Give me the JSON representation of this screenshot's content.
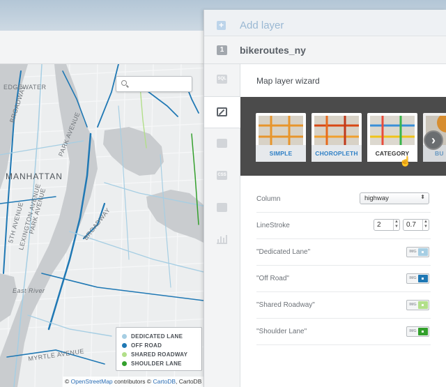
{
  "map": {
    "labels": [
      "EDGEWATER",
      "MANHATTAN",
      "BROADWAY",
      "PARK AVENUE",
      "BROADWAY",
      "East River",
      "MYRTLE AVENUE",
      "LEXINGTON AVENUE",
      "5TH AVENUE",
      "PARK AVENUE"
    ],
    "legend": [
      {
        "label": "DEDICATED LANE",
        "color": "#a6cee3"
      },
      {
        "label": "OFF ROAD",
        "color": "#1f78b4"
      },
      {
        "label": "SHARED ROADWAY",
        "color": "#b2df8a"
      },
      {
        "label": "SHOULDER LANE",
        "color": "#33a02c"
      }
    ],
    "attribution": {
      "prefix": "©",
      "osm": "OpenStreetMap",
      "middle": "contributors ©",
      "carto": "CartoDB",
      "suffix": ", CartoDB"
    }
  },
  "pane": {
    "add_layer": "Add layer",
    "layer_number": "1",
    "layer_name": "bikeroutes_ny",
    "tabs": {
      "sql": "SQL",
      "css": "CSS"
    }
  },
  "wizard": {
    "title": "Map layer wizard",
    "cards": [
      {
        "label": "SIMPLE"
      },
      {
        "label": "CHOROPLETH"
      },
      {
        "label": "CATEGORY",
        "selected": true
      },
      {
        "label": "BU"
      }
    ],
    "column": {
      "label": "Column",
      "value": "highway"
    },
    "linestroke": {
      "label": "LineStroke",
      "width": "2",
      "opacity": "0.7"
    },
    "categories": [
      {
        "label": "\"Dedicated Lane\"",
        "color": "#a6cee3"
      },
      {
        "label": "\"Off Road\"",
        "color": "#1f78b4"
      },
      {
        "label": "\"Shared Roadway\"",
        "color": "#b2df8a"
      },
      {
        "label": "\"Shoulder Lane\"",
        "color": "#33a02c"
      }
    ],
    "swatch_img": "IMG"
  }
}
